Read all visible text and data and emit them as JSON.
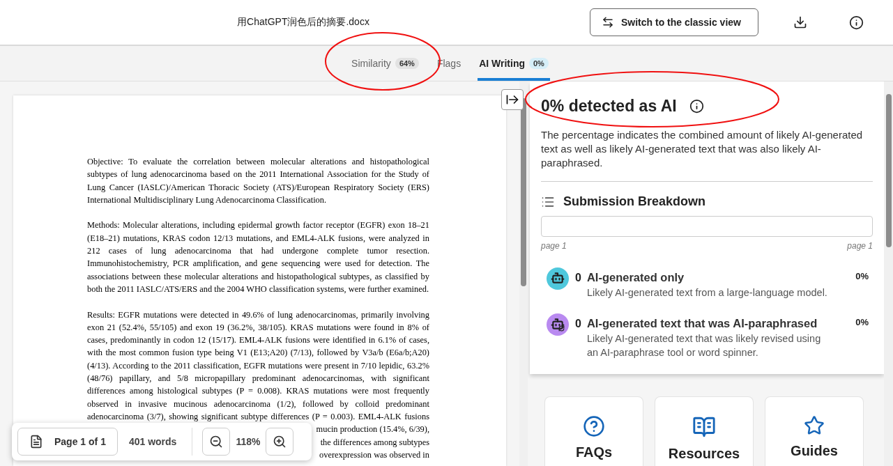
{
  "document_title": "用ChatGPT润色后的摘要.docx",
  "switch_button": "Switch to the classic view",
  "tabs": [
    {
      "label": "Similarity",
      "badge": "64%",
      "selected": false
    },
    {
      "label": "Flags",
      "selected": false
    },
    {
      "label": "AI Writing",
      "badge": "0%",
      "selected": true
    }
  ],
  "document": {
    "paragraphs": [
      {
        "lines": [
          "Objective: To evaluate the correlation between molecular alterations and histopathological",
          "subtypes of lung adenocarcinoma based on the 2011 International Association for the Study of",
          "Lung Cancer (IASLC)/American Thoracic Society (ATS)/European Respiratory Society (ERS)",
          "International Multidisciplinary Lung Adenocarcinoma Classification."
        ]
      },
      {
        "lines": [
          "Methods: Molecular alterations, including epidermal growth factor receptor (EGFR) exon 18–21",
          "(E18–21) mutations, KRAS codon 12/13 mutations, and EML4-ALK fusions, were analyzed in",
          "212 cases of lung adenocarcinoma that had undergone complete tumor resection.",
          "Immunohistochemistry, PCR amplification, and gene sequencing were used for detection. The",
          "associations between these molecular alterations and histopathological subtypes, as classified by",
          "both the 2011 IASLC/ATS/ERS and the 2004 WHO classification systems, were further examined."
        ]
      },
      {
        "lines": [
          "Results: EGFR mutations were detected in 49.6% of lung adenocarcinomas, primarily involving",
          "exon 21 (52.4%, 55/105) and exon 19 (36.2%, 38/105). KRAS mutations were found in 8% of",
          "cases, predominantly in codon 12 (15/17). EML4-ALK fusions were identified in 6.1% of cases,",
          "with the most common fusion type being V1 (E13;A20) (7/13), followed by V3a/b (E6a/b;A20)",
          "(4/13). According to the 2011 classification, EGFR mutations were present in 7/10 lepidic, 63.2%",
          "(48/76) papillary, and 5/8 micropapillary predominant adenocarcinomas, with significant",
          "differences among histological subtypes (P = 0.008). KRAS mutations were most frequently",
          "observed in invasive mucinous adenocarcinoma (1/2), followed by colloid predominant",
          "adenocarcinoma (3/7), showing significant subtype differences (P = 0.003). EML4-ALK fusions"
        ],
        "continues": true
      }
    ],
    "partial_lines": [
      "mucin production (15.4%, 6/39),",
      "the differences among subtypes",
      "overexpression was observed in"
    ]
  },
  "viewer_toolbar": {
    "page": "Page 1 of 1",
    "words": "401 words",
    "zoom": "118%"
  },
  "ai_panel": {
    "heading": "0% detected as AI",
    "description": "The percentage indicates the combined amount of likely AI-generated text as well as likely AI-generated text that was also likely AI-paraphrased.",
    "breakdown_title": "Submission Breakdown",
    "page_start": "page 1",
    "page_end": "page 1",
    "categories": [
      {
        "kind": "generated",
        "count": "0",
        "title": "AI-generated only",
        "description": "Likely AI-generated text from a large-language model.",
        "percent": "0%",
        "color": "#4fc8dc"
      },
      {
        "kind": "paraphrased",
        "count": "0",
        "title": "AI-generated text that was AI-paraphrased",
        "description": "Likely AI-generated text that was likely revised using an AI-paraphrase tool or word spinner.",
        "percent": "0%",
        "color": "#b98af0"
      }
    ]
  },
  "resources": [
    {
      "kind": "faq",
      "label": "FAQs"
    },
    {
      "kind": "resources",
      "label": "Resources"
    },
    {
      "kind": "guides",
      "label": "Guides"
    }
  ]
}
